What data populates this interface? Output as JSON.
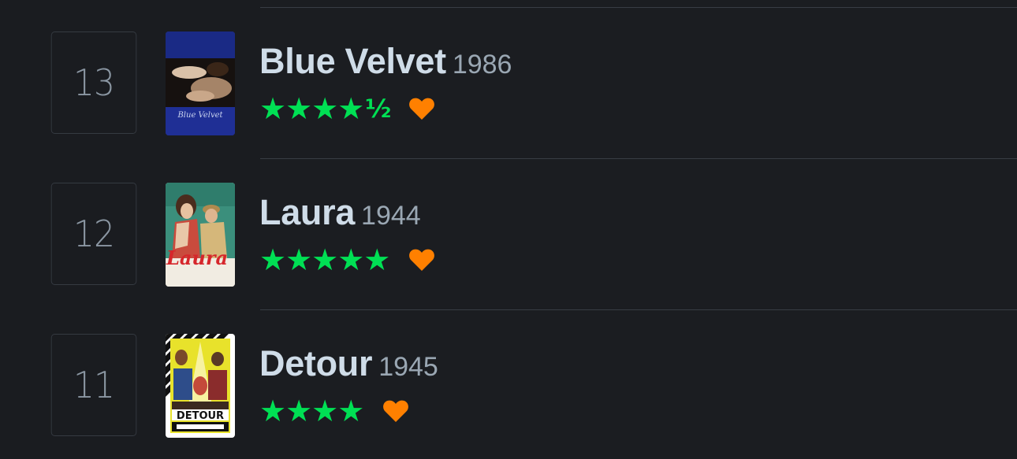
{
  "entries": [
    {
      "rank": "13",
      "title": "Blue Velvet",
      "year": "1986",
      "stars": "★★★★",
      "half": "½",
      "liked": true,
      "poster_caption": "Blue Velvet",
      "poster_icon": "poster-blue-velvet"
    },
    {
      "rank": "12",
      "title": "Laura",
      "year": "1944",
      "stars": "★★★★★",
      "half": "",
      "liked": true,
      "poster_caption": "Laura",
      "poster_icon": "poster-laura"
    },
    {
      "rank": "11",
      "title": "Detour",
      "year": "1945",
      "stars": "★★★★",
      "half": "",
      "liked": true,
      "poster_caption": "DETOUR",
      "poster_icon": "poster-detour"
    }
  ],
  "colors": {
    "background": "#1b1d21",
    "star_green": "#00e054",
    "heart_orange": "#ff8000",
    "title_text": "#cfdce8",
    "year_text": "#9aa7b3",
    "rank_text": "#8b97a3",
    "divider": "#383d44"
  }
}
